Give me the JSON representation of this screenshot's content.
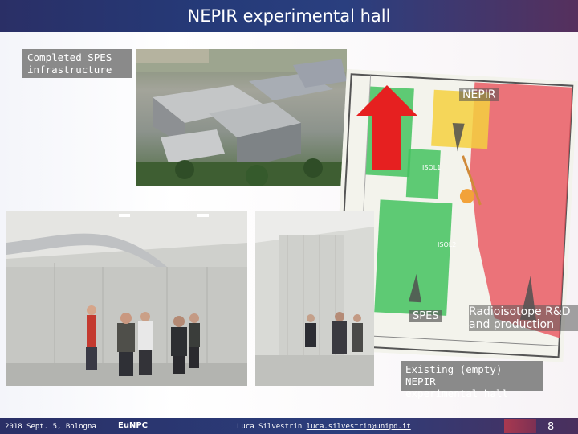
{
  "header": {
    "title": "NEPIR experimental hall"
  },
  "labels": {
    "completed_spes": "Completed SPES\ninfrastructure",
    "existing_hall": "Existing (empty) NEPIR\nexperimental hall"
  },
  "plan": {
    "nepir": "NEPIR",
    "spes": "SPES",
    "radioisotope": "Radioisotope R&D\nand production",
    "isol1": "ISOL1",
    "isol2": "ISOL2"
  },
  "footer": {
    "date_place": "2018 Sept. 5, Bologna",
    "event": "EuNPC",
    "author": "Luca Silvestrin",
    "email": "luca.silvestrin@unipd.it",
    "page": "8"
  },
  "colors": {
    "banner": "#2a3578",
    "label_bg": "#8a8a8a",
    "plan_red": "#e8525d",
    "plan_green": "#43c25f",
    "plan_yellow": "#f5d040",
    "arrow_red": "#e62020"
  }
}
